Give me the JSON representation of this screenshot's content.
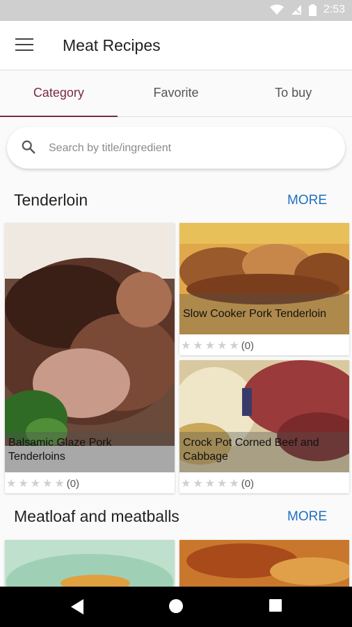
{
  "status": {
    "time": "2:53"
  },
  "appbar": {
    "title": "Meat Recipes",
    "menu_icon": "hamburger-menu-icon"
  },
  "tabs": [
    {
      "label": "Category",
      "active": true
    },
    {
      "label": "Favorite",
      "active": false
    },
    {
      "label": "To buy",
      "active": false
    }
  ],
  "search": {
    "placeholder": "Search by title/ingredient"
  },
  "sections": [
    {
      "title": "Tenderloin",
      "more": "MORE",
      "cards": [
        {
          "title": "Balsamic Glaze Pork Tenderloins",
          "rating": "(0)"
        },
        {
          "title": "Slow Cooker Pork Tenderloin",
          "rating": "(0)"
        },
        {
          "title": "Crock Pot Corned Beef and Cabbage",
          "rating": "(0)"
        }
      ]
    },
    {
      "title": "Meatloaf and meatballs",
      "more": "MORE"
    }
  ],
  "colors": {
    "accent": "#7a2b42",
    "link": "#1f6fc0"
  }
}
